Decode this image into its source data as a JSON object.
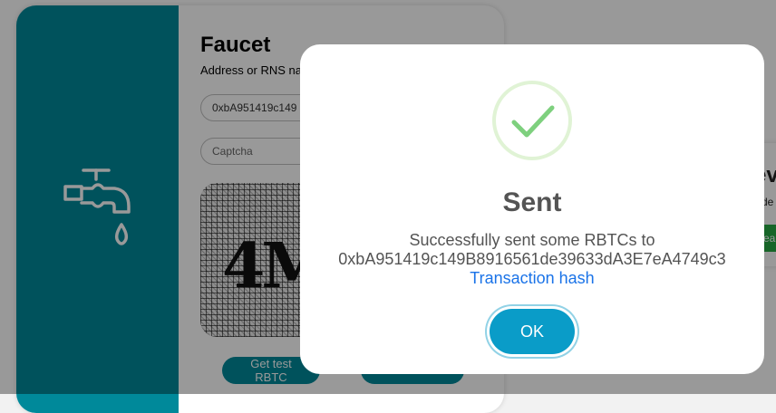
{
  "faucet": {
    "title": "Faucet",
    "address_label": "Address or RNS na",
    "address_value": "0xbA951419c149",
    "captcha_placeholder": "Captcha",
    "captcha_text": "4M",
    "get_button": "Get test RBTC",
    "second_button": ""
  },
  "side_card": {
    "title": "ev",
    "subtitle": "de",
    "button": "ea"
  },
  "dialog": {
    "title": "Sent",
    "message": "Successfully sent some RBTCs to",
    "address": "0xbA951419c149B8916561de39633dA3E7eA4749c3",
    "link": "Transaction hash",
    "ok": "OK"
  },
  "colors": {
    "faucet_teal": "#00899a",
    "ok_button": "#0a9cc8",
    "success_check": "#7ed07e",
    "link": "#1a73e8"
  }
}
